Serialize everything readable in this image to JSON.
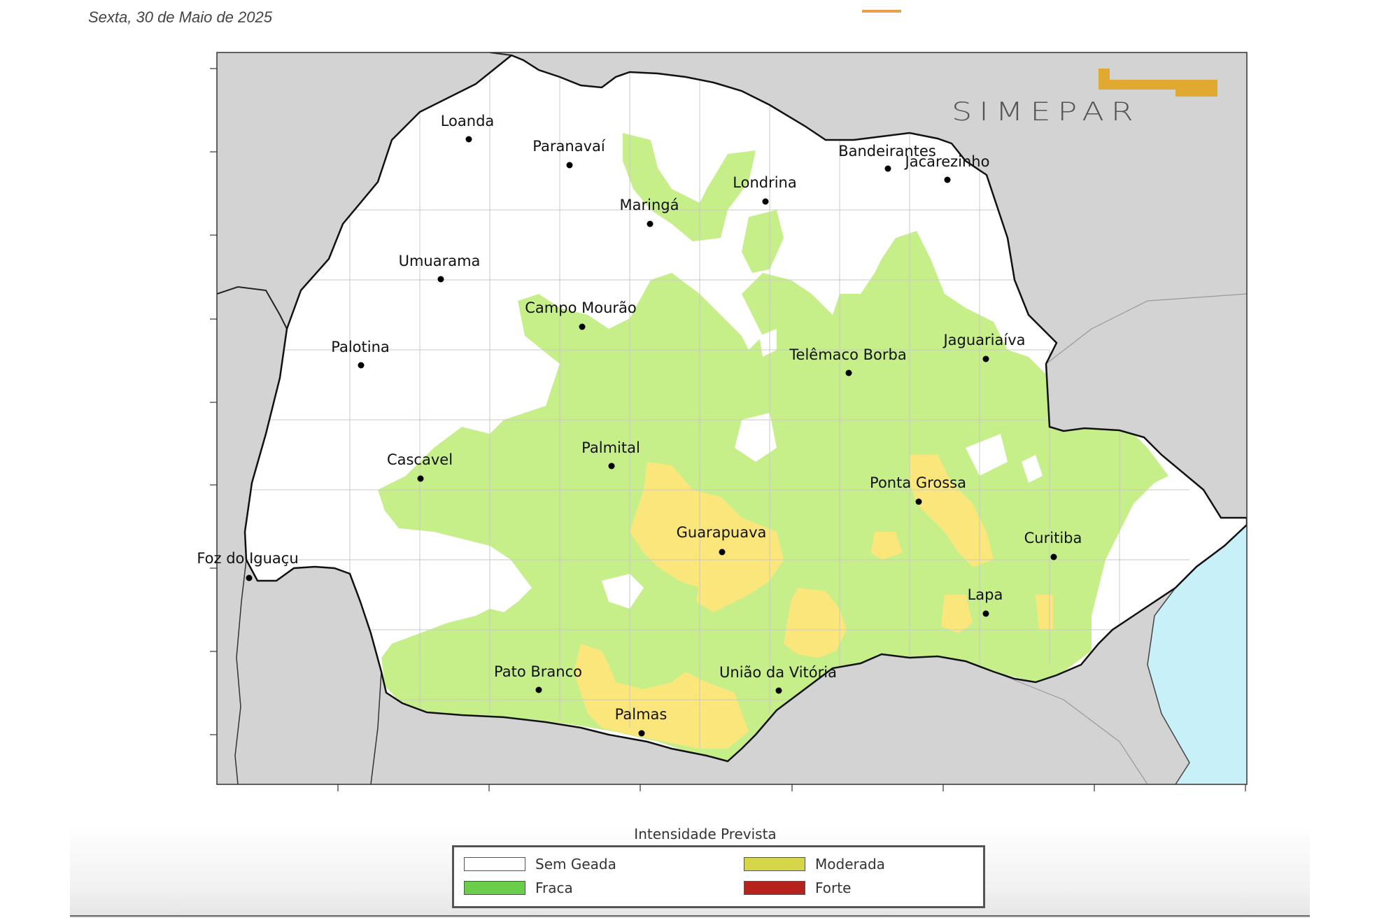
{
  "header": {
    "date": "Sexta, 30 de Maio de 2025"
  },
  "logo": {
    "text": "SIMEPAR",
    "accent_color": "#e0a930"
  },
  "map": {
    "cities": [
      {
        "name": "Loanda"
      },
      {
        "name": "Paranavaí"
      },
      {
        "name": "Maringá"
      },
      {
        "name": "Londrina"
      },
      {
        "name": "Bandeirantes"
      },
      {
        "name": "Jacarezinho"
      },
      {
        "name": "Umuarama"
      },
      {
        "name": "Campo Mourão"
      },
      {
        "name": "Palotina"
      },
      {
        "name": "Telêmaco Borba"
      },
      {
        "name": "Jaguariaíva"
      },
      {
        "name": "Palmital"
      },
      {
        "name": "Cascavel"
      },
      {
        "name": "Ponta Grossa"
      },
      {
        "name": "Guarapuava"
      },
      {
        "name": "Curitiba"
      },
      {
        "name": "Foz do Iguaçu"
      },
      {
        "name": "Lapa"
      },
      {
        "name": "Pato Branco"
      },
      {
        "name": "União da Vitória"
      },
      {
        "name": "Palmas"
      }
    ],
    "colors": {
      "outside": "#d3d3d3",
      "ocean": "#c8f0f8",
      "sem_geada": "#ffffff",
      "fraca": "#c6ef8a",
      "moderada": "#fbe67c",
      "forte": "#b5231c"
    }
  },
  "legend": {
    "title": "Intensidade Prevista",
    "items": [
      {
        "label": "Sem Geada",
        "color": "#ffffff"
      },
      {
        "label": "Moderada",
        "color": "#d6d64a"
      },
      {
        "label": "Fraca",
        "color": "#6bce4a"
      },
      {
        "label": "Forte",
        "color": "#b5231c"
      }
    ]
  }
}
